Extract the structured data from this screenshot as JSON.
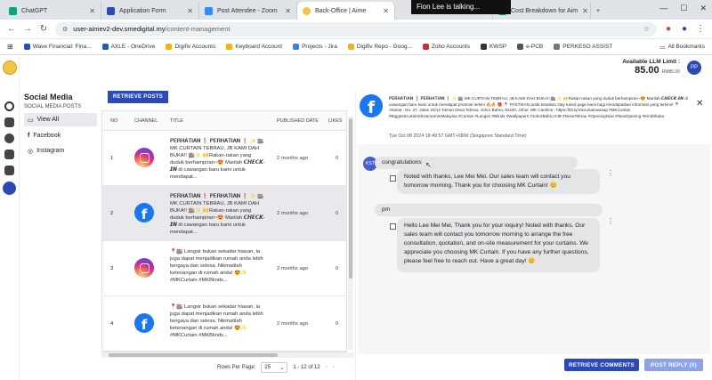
{
  "browser": {
    "tabs": [
      {
        "label": "ChatGPT",
        "color": "#10a37f"
      },
      {
        "label": "Application Form",
        "color": "#2c49b8"
      },
      {
        "label": "Post Attendee - Zoom",
        "color": "#2d8cff"
      },
      {
        "label": "Back-Office | Aime",
        "color": "#f6c445"
      },
      {
        "label": "",
        "color": "#888888"
      },
      {
        "label": "Cost Breakdown for Aim",
        "color": "#0f9d58"
      }
    ],
    "call_overlay": "Fion Lee is talking...",
    "url_host": "user-aimev2-dev.smedigital.my",
    "url_path": "/content-management",
    "bookmarks": [
      {
        "label": "Wave Financial: Fina...",
        "color": "#1c4fd8"
      },
      {
        "label": "AXLE - OneDrive",
        "color": "#0a66c2"
      },
      {
        "label": "Digifiv Accounts",
        "color": "#f4b400"
      },
      {
        "label": "Keyboard Account",
        "color": "#f4b400"
      },
      {
        "label": "Projects - Jira",
        "color": "#2684ff"
      },
      {
        "label": "Digifiv Repo - Goog...",
        "color": "#f4b400"
      },
      {
        "label": "Zoho Accounts",
        "color": "#e42527"
      },
      {
        "label": "KWSP",
        "color": "#333333"
      },
      {
        "label": "e-PCB",
        "color": "#555555"
      },
      {
        "label": "PERKESO ASSIST",
        "color": "#777777"
      }
    ],
    "all_bookmarks": "All Bookmarks"
  },
  "header": {
    "llm_label": "Available LLM Limit :",
    "llm_amount": "85.00",
    "llm_unit": "RM85.00",
    "avatar": "PP"
  },
  "sidebar": {
    "title": "Social Media",
    "subtitle": "SOCIAL MEDIA POSTS",
    "items": [
      {
        "label": "View All",
        "icon": "laptop-icon"
      },
      {
        "label": "Facebook",
        "icon": "facebook-icon"
      },
      {
        "label": "Instagram",
        "icon": "instagram-icon"
      }
    ]
  },
  "posts": {
    "retrieve_label": "RETRIEVE POSTS",
    "columns": [
      "NO",
      "CHANNEL",
      "TITLE",
      "PUBLISHED DATE",
      "LIKES"
    ],
    "rows": [
      {
        "no": "1",
        "channel": "instagram",
        "title": "𝐏𝐄𝐑𝐇𝐀𝐓𝐈𝐀𝐍 ❗ 𝐏𝐄𝐑𝐇𝐀𝐓𝐈𝐀𝐍 ❗ ✨ 🏬 MK CURTAIN TEBRAU, JB KAMI DAH BUKA!! 🏬✨ 🙌Rakan-rakan yang duduk berhampiran~😍 Marilah 𝘾𝙃𝙀𝘾𝙆-𝙄𝙉 di cawangan baru kami untuk mendapat...",
        "date": "2 months ago",
        "likes": "0"
      },
      {
        "no": "2",
        "channel": "facebook",
        "title": "𝐏𝐄𝐑𝐇𝐀𝐓𝐈𝐀𝐍 ❗ 𝐏𝐄𝐑𝐇𝐀𝐓𝐈𝐀𝐍 ❗ ✨ 🏬 MK CURTAIN TEBRAU, JB KAMI DAH BUKA!! 🏬✨ 🙌Rakan-rakan yang duduk berhampiran~😍 Marilah 𝘾𝙃𝙀𝘾𝙆-𝙄𝙉 di cawangan baru kami untuk mendapat...",
        "date": "2 months ago",
        "likes": "0"
      },
      {
        "no": "3",
        "channel": "instagram",
        "title": "📍🏬 Langsir bukan sekadar hiasan, ia juga dapat menjadikan rumah anda lebih bergaya dan selesa. Nikmatilah ketenangan di rumah anda! 😍✨ #MKCurtain #MKBlinds...",
        "date": "2 months ago",
        "likes": "0"
      },
      {
        "no": "4",
        "channel": "facebook",
        "title": "📍🏬 Langsir bukan sekadar hiasan, ia juga dapat menjadikan rumah anda lebih bergaya dan selesa. Nikmatilah ketenangan di rumah anda! 😍✨ #MKCurtain #MKBlinds...",
        "date": "2 months ago",
        "likes": "0"
      }
    ],
    "selected_row": 2,
    "rows_per_page_label": "Rows Per Page:",
    "rows_per_page": "25",
    "range": "1 - 12 of 12"
  },
  "detail": {
    "post_text": "𝐏𝐄𝐑𝐇𝐀𝐓𝐈𝐀𝐍 ❗ 𝐏𝐄𝐑𝐇𝐀𝐓𝐈𝐀𝐍 ❗ ✨ 🏬 MK CURTAIN TEBRAU, JB KAMI DAH BUKA!! 🏬 ✨ 🙌Rakan-rakan yang duduk berhampiran~😍 Marilah 𝘾𝙃𝙀𝘾𝙆-𝙄𝙉 di cawangan baru kami untuk mendapat promosi terkini 🔥🔥 🎁 📍 PASTIKAN anda tesaikan stay tuned page kami bagi mendapatkan informasi yang terkini!! 📍 Alamat : No. 37, Jalan 23/12 Taman Desa Tebrau, Johor Bahru, 81100, Johor. MK Caroline : https://bit.ly/mkcurtainwasap #MKCurtain #BiggestCurtainShowroomInMalaysia #Curtain #Langsir #Blinds #Wallpapers #JohorBahru #JB #DesaTebrau #OpeningNow #NewOpening #KiniDibuka",
    "post_time": "Tue Oct 08 2024 18:49:57 GMT+0800 (Singapore Standard Time)",
    "commenter": "KST",
    "comment1": "congratulations",
    "reply1": "Noted with thanks, Lee Mei Mei. Our sales team will contact you tomorrow morning. Thank you for choosing MK Curtain! 😊",
    "comment2": "pm",
    "reply2": "Hello Lee Mei Mei, Thank you for your inquiry! Noted with thanks. Our sales team will contact you tomorrow morning to arrange the free consultation, quotation, and on-site measurement for your curtains. We appreciate you choosing MK Curtain. If you have any further questions, please feel free to reach out. Have a great day! 😊",
    "retrieve_comments": "RETRIEVE COMMENTS",
    "post_reply": "POST REPLY (0)"
  }
}
